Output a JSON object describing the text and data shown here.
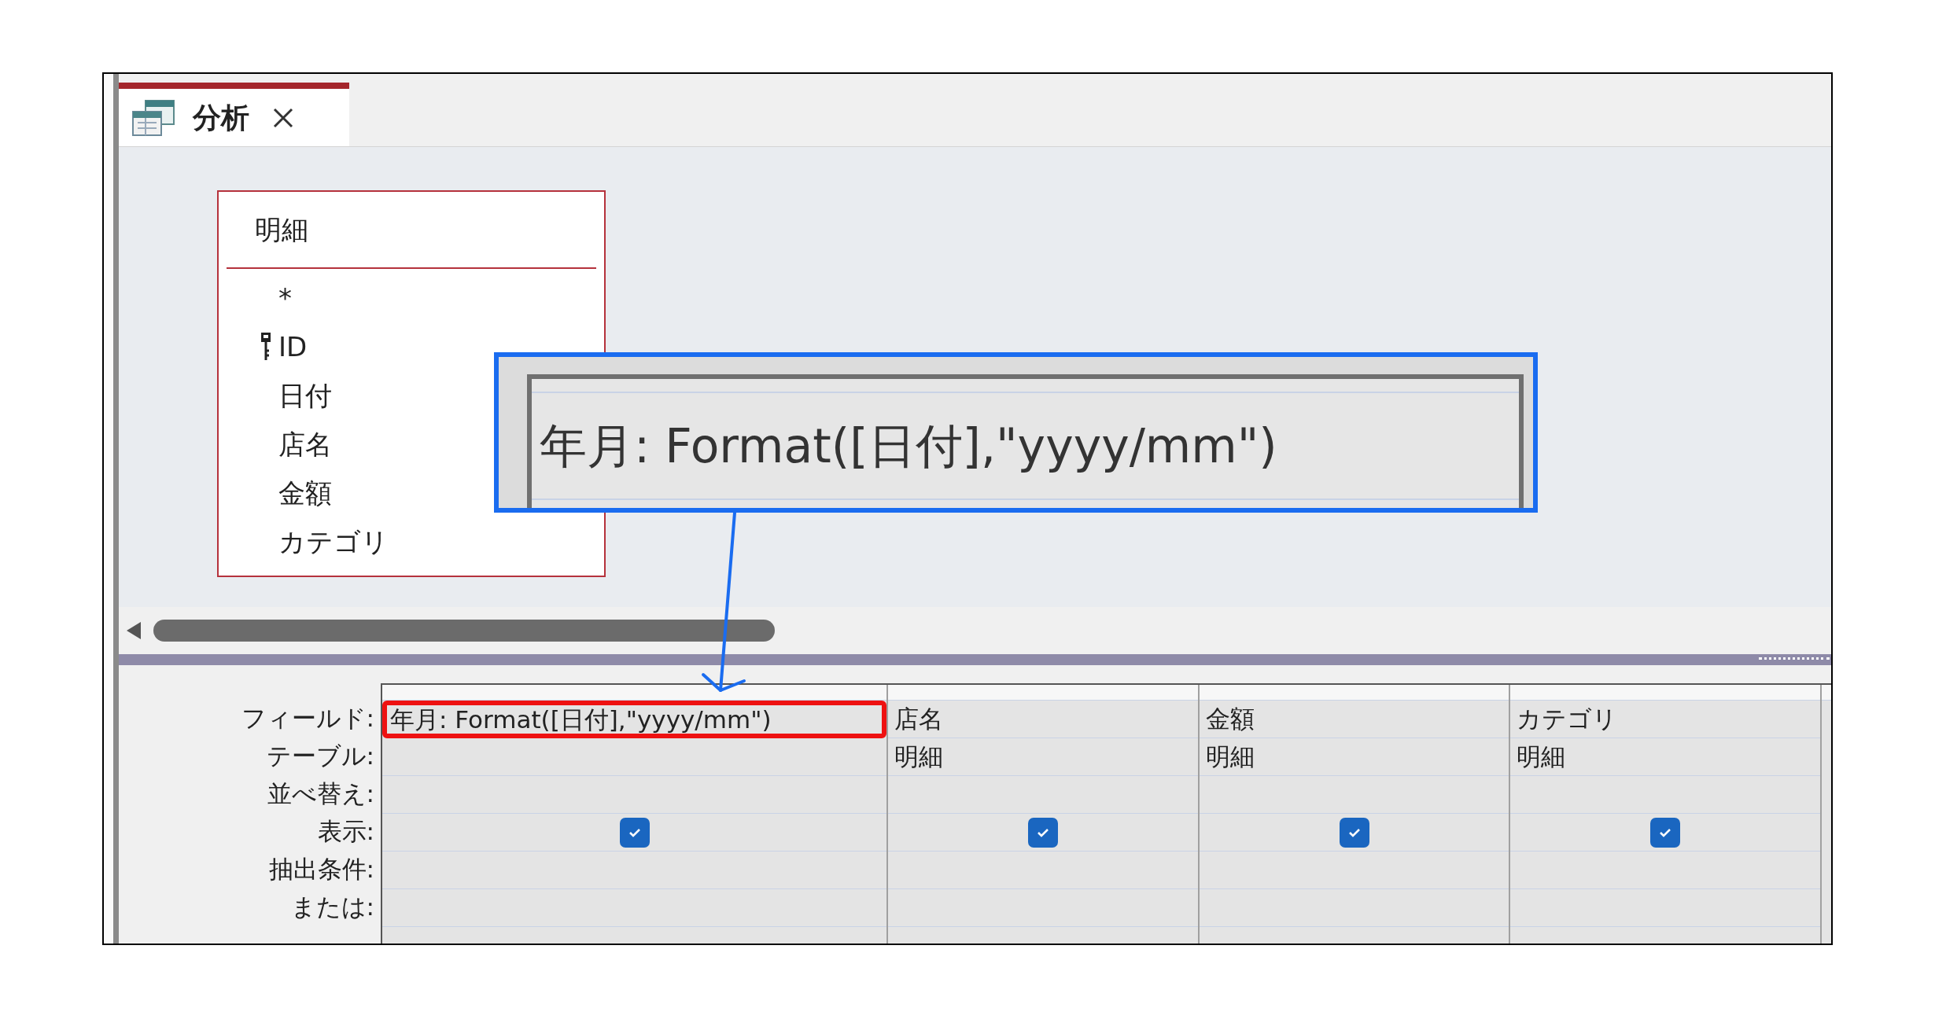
{
  "tab": {
    "title": "分析",
    "selected": true
  },
  "table_box": {
    "title": "明細",
    "fields": [
      {
        "name": "*",
        "key": false
      },
      {
        "name": "ID",
        "key": true
      },
      {
        "name": "日付",
        "key": false
      },
      {
        "name": "店名",
        "key": false
      },
      {
        "name": "金額",
        "key": false
      },
      {
        "name": "カテゴリ",
        "key": false
      }
    ]
  },
  "callout": {
    "text": "年月: Format([日付],\"yyyy/mm\")"
  },
  "grid": {
    "row_labels": [
      "フィールド:",
      "テーブル:",
      "並べ替え:",
      "表示:",
      "抽出条件:",
      "または:"
    ],
    "columns": [
      {
        "field": "年月: Format([日付],\"yyyy/mm\")",
        "show": true,
        "highlighted": true
      },
      {
        "field": "店名",
        "table": "明細",
        "show": true,
        "highlighted": false
      },
      {
        "field": "金額",
        "table": "明細",
        "show": true,
        "highlighted": false
      },
      {
        "field": "カテゴリ",
        "table": "明細",
        "show": true,
        "highlighted": false
      }
    ]
  }
}
